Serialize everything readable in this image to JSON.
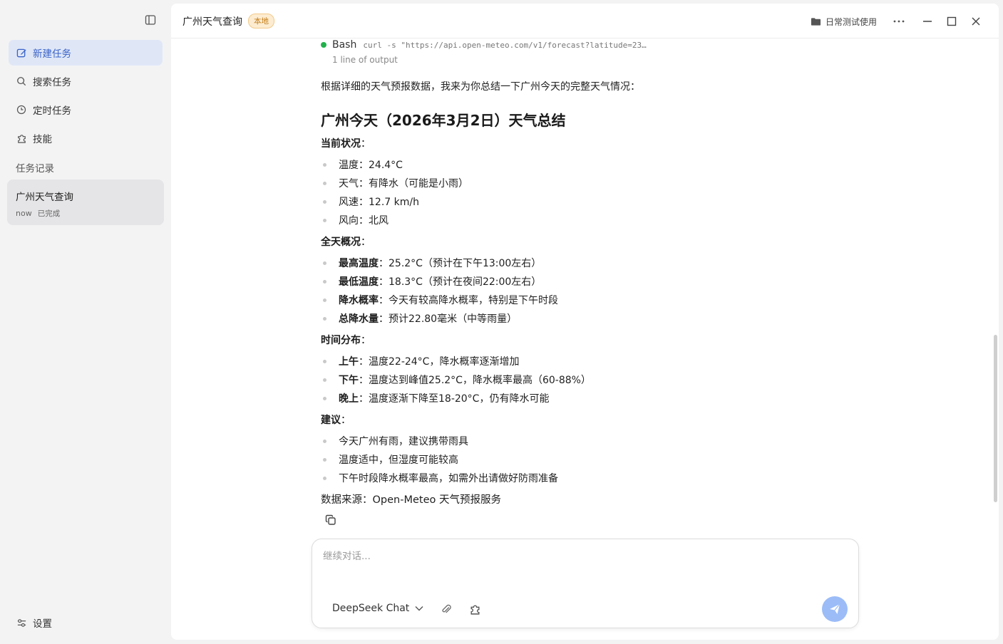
{
  "colors": {
    "accent": "#3a63c8",
    "badge": "#c27a14",
    "status_ok": "#22b14c",
    "send": "#9bbcf7"
  },
  "sidebar": {
    "toggle_icon": "sidebar-toggle-icon",
    "nav": [
      {
        "label": "新建任务",
        "icon": "edit-icon"
      },
      {
        "label": "搜索任务",
        "icon": "search-icon"
      },
      {
        "label": "定时任务",
        "icon": "clock-icon"
      },
      {
        "label": "技能",
        "icon": "puzzle-icon"
      }
    ],
    "section_label": "任务记录",
    "tasks": [
      {
        "title": "广州天气查询",
        "time": "now",
        "status": "已完成"
      }
    ],
    "settings_label": "设置"
  },
  "header": {
    "title": "广州天气查询",
    "badge": "本地",
    "folder": "日常测试使用",
    "more": "···"
  },
  "tool_call": {
    "name": "Bash",
    "command": "curl -s \"https://api.open-meteo.com/v1/forecast?latitude=23…",
    "output_summary": "1 line of output"
  },
  "message": {
    "intro": "根据详细的天气预报数据，我来为你总结一下广州今天的完整天气情况：",
    "heading": "广州今天（2026年3月2日）天气总结",
    "sections": [
      {
        "title": "当前状况",
        "items": [
          {
            "key": "",
            "text": "温度：24.4°C"
          },
          {
            "key": "",
            "text": "天气：有降水（可能是小雨）"
          },
          {
            "key": "",
            "text": "风速：12.7 km/h"
          },
          {
            "key": "",
            "text": "风向：北风"
          }
        ]
      },
      {
        "title": "全天概况",
        "items": [
          {
            "key": "最高温度",
            "text": "：25.2°C（预计在下午13:00左右）"
          },
          {
            "key": "最低温度",
            "text": "：18.3°C（预计在夜间22:00左右）"
          },
          {
            "key": "降水概率",
            "text": "：今天有较高降水概率，特别是下午时段"
          },
          {
            "key": "总降水量",
            "text": "：预计22.80毫米（中等雨量）"
          }
        ]
      },
      {
        "title": "时间分布",
        "items": [
          {
            "key": "上午",
            "text": "：温度22-24°C，降水概率逐渐增加"
          },
          {
            "key": "下午",
            "text": "：温度达到峰值25.2°C，降水概率最高（60-88%）"
          },
          {
            "key": "晚上",
            "text": "：温度逐渐下降至18-20°C，仍有降水可能"
          }
        ]
      },
      {
        "title": "建议",
        "items": [
          {
            "key": "",
            "text": "今天广州有雨，建议携带雨具"
          },
          {
            "key": "",
            "text": "温度适中，但湿度可能较高"
          },
          {
            "key": "",
            "text": "下午时段降水概率最高，如需外出请做好防雨准备"
          }
        ]
      }
    ],
    "section_colon": "：",
    "source": "数据来源：Open-Meteo 天气预报服务"
  },
  "composer": {
    "placeholder": "继续对话...",
    "model": "DeepSeek Chat"
  }
}
